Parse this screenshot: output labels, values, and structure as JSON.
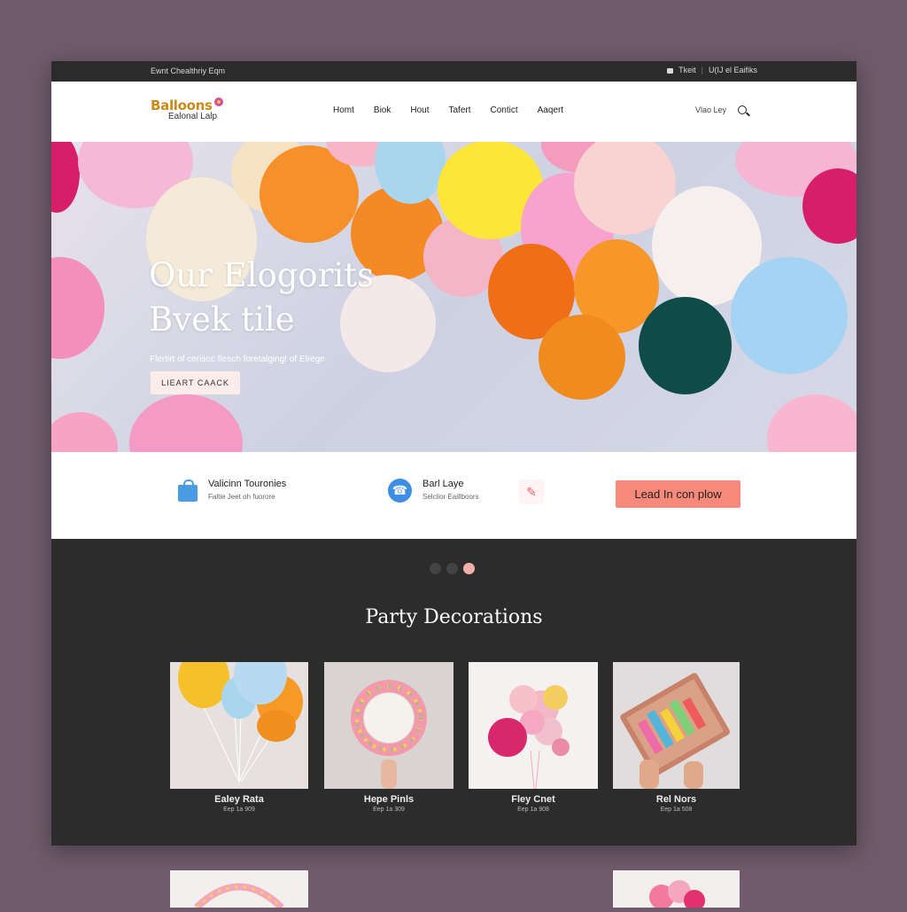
{
  "topbar": {
    "left": "Ewnt Chealthriy Eqm",
    "right_1": "Tkeit",
    "right_2": "U(IJ el Eaifiks"
  },
  "header": {
    "logo_line1": "Balloons",
    "logo_line2": "Ealonal Lalp",
    "nav": [
      "Homt",
      "Biok",
      "Hout",
      "Tafert",
      "Contict",
      "Aaqert"
    ],
    "account": "Vlao Ley"
  },
  "hero": {
    "title": "Our Elogorits Bvek tile",
    "subtitle": "Flertirt of cerisoc flesch foretalging! of Elrege",
    "cta": "LIEART CAACK"
  },
  "features": {
    "item1_title": "Valicinn Touronies",
    "item1_sub": "Faltie Jeet oh fuorore",
    "item2_title": "Barl Laye",
    "item2_sub": "Selclior Eaillboors",
    "button": "Lead In con plow"
  },
  "carousel": {
    "dots": 3,
    "active": 3
  },
  "section": {
    "title": "Party Decorations"
  },
  "products": [
    {
      "name": "Ealey Rata",
      "price": "Eep 1a 909"
    },
    {
      "name": "Hepe Pinls",
      "price": "Eep 1a 309"
    },
    {
      "name": "Fley Cnet",
      "price": "Eep 1a 908"
    },
    {
      "name": "Rel Nors",
      "price": "Eep 1a 508"
    }
  ],
  "colors": {
    "accent": "#f6897a",
    "dark": "#2c2c2c",
    "background": "#6f5b6b",
    "icon_blue": "#3c8fe4"
  },
  "icons": [
    "lock-icon",
    "search-icon",
    "shopping-bag-icon",
    "phone-icon",
    "pencil-icon"
  ]
}
